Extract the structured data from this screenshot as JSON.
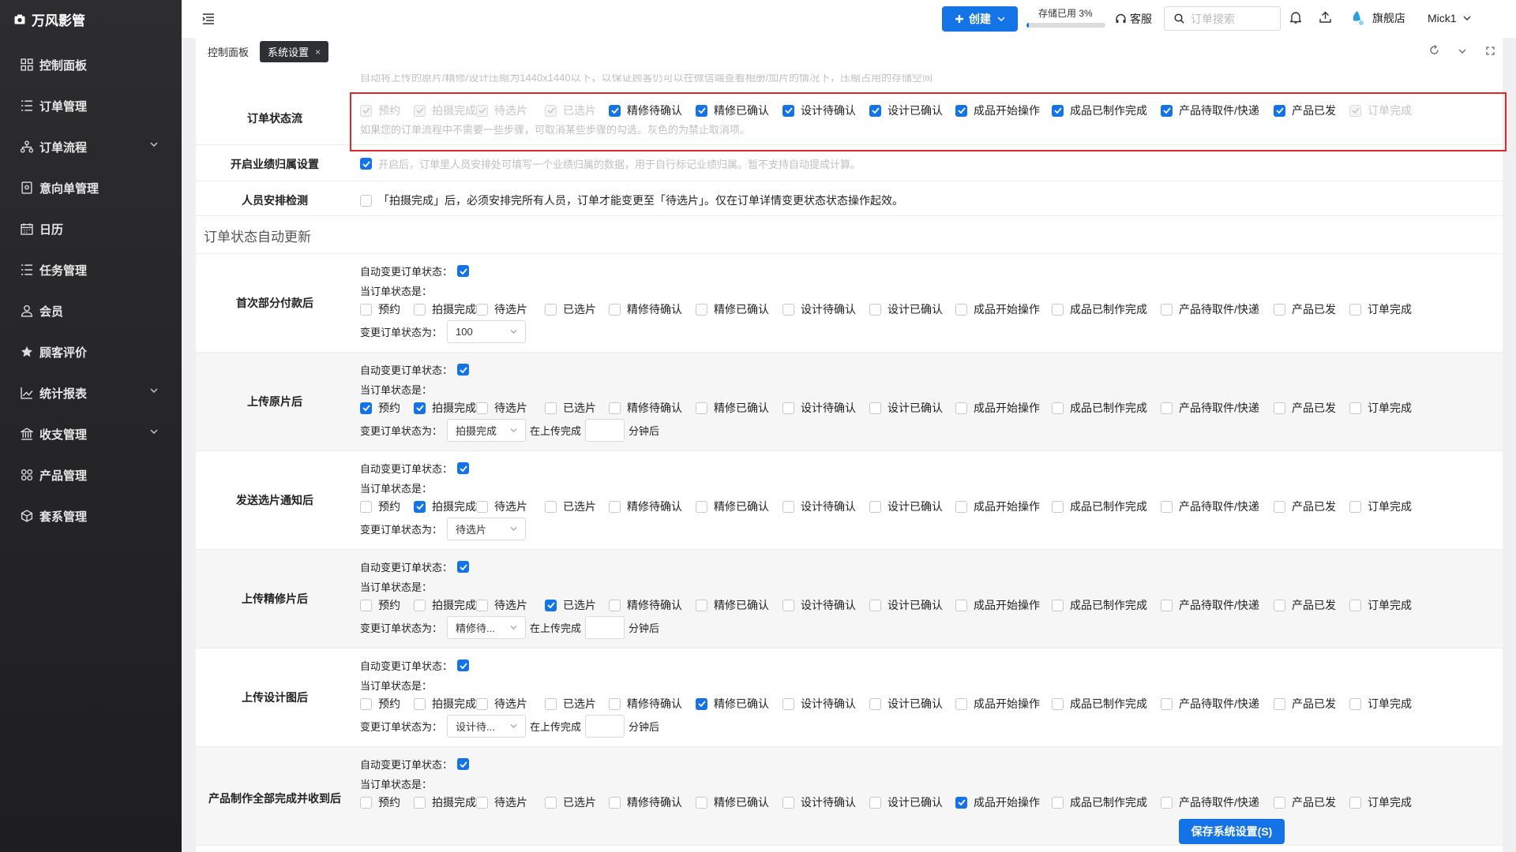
{
  "app": {
    "name": "万风影管"
  },
  "sidebar": {
    "items": [
      {
        "label": "控制面板"
      },
      {
        "label": "订单管理"
      },
      {
        "label": "订单流程"
      },
      {
        "label": "意向单管理"
      },
      {
        "label": "日历"
      },
      {
        "label": "任务管理"
      },
      {
        "label": "会员"
      },
      {
        "label": "顾客评价"
      },
      {
        "label": "统计报表"
      },
      {
        "label": "收支管理"
      },
      {
        "label": "产品管理"
      },
      {
        "label": "套系管理"
      }
    ]
  },
  "topbar": {
    "create_label": "创建",
    "storage_label": "存储已用 3%",
    "storage_percent": 3,
    "service_label": "客服",
    "search_placeholder": "订单搜索",
    "store_name": "旗舰店",
    "user_name": "Mick1"
  },
  "tabs": {
    "dashboard": "控制面板",
    "settings": "系统设置"
  },
  "top_hint": "自动将上传的原片/精修/设计压缩为1440x1440以下，以保证顾客仍可以在微信端查看相册/加片的情况下，压缩占用的存储空间",
  "statuses": [
    "预约",
    "拍摄完成",
    "待选片",
    "已选片",
    "精修待确认",
    "精修已确认",
    "设计待确认",
    "设计已确认",
    "成品开始操作",
    "成品已制作完成",
    "产品待取件/快递",
    "产品已发",
    "订单完成"
  ],
  "flow": {
    "label": "订单状态流",
    "hint": "如果您的订单流程中不需要一些步骤，可取消某些步骤的勾选。灰色的为禁止取消项。"
  },
  "performance": {
    "label": "开启业绩归属设置",
    "hint": "开启后，订单里人员安排处可填写一个业绩归属的数据，用于自行标记业绩归属。暂不支持自动提成计算。"
  },
  "staff_check": {
    "label": "人员安排检测",
    "text": "「拍摄完成」后，必须安排完所有人员，订单才能变更至「待选片」。仅在订单详情变更状态状态操作起效。"
  },
  "auto_section_title": "订单状态自动更新",
  "auto_labels": {
    "auto_change": "自动变更订单状态：",
    "current_status": "当订单状态是：",
    "change_to": "变更订单状态为：",
    "after_upload": "在上传完成",
    "minutes_after": "分钟后"
  },
  "rules": [
    {
      "label": "首次部分付款后",
      "target": "100"
    },
    {
      "label": "上传原片后",
      "target": "拍摄完成"
    },
    {
      "label": "发送选片通知后",
      "target": "待选片"
    },
    {
      "label": "上传精修片后",
      "target": "精修待..."
    },
    {
      "label": "上传设计图后",
      "target": "设计待..."
    },
    {
      "label": "产品制作全部完成并收到后",
      "target": ""
    }
  ],
  "save_label": "保存系统设置(S)"
}
